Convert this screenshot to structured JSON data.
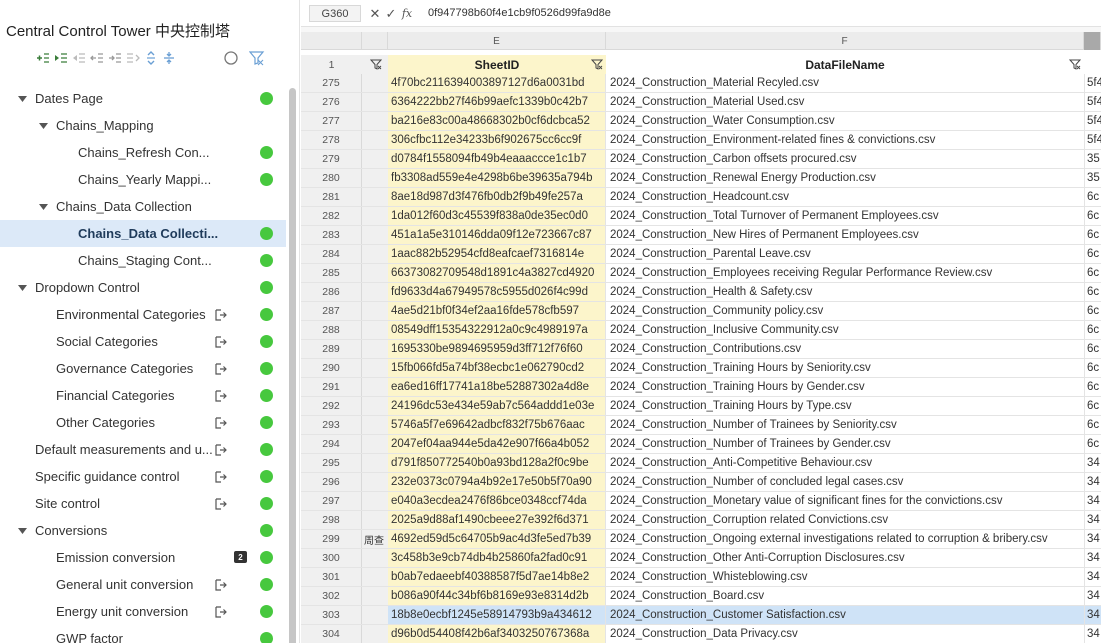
{
  "sidebar": {
    "title": "Central Control Tower 中央控制塔",
    "tree": [
      {
        "label": "Dates Page",
        "level": 0,
        "expanded": true,
        "status": "green"
      },
      {
        "label": "Chains_Mapping",
        "level": 1,
        "expanded": true
      },
      {
        "label": "Chains_Refresh Con...",
        "level": 2,
        "status": "green"
      },
      {
        "label": "Chains_Yearly Mappi...",
        "level": 2,
        "status": "green"
      },
      {
        "label": "Chains_Data Collection",
        "level": 1,
        "expanded": true
      },
      {
        "label": "Chains_Data Collecti...",
        "level": 2,
        "status": "green",
        "selected": true
      },
      {
        "label": "Chains_Staging Cont...",
        "level": 2,
        "status": "green"
      },
      {
        "label": "Dropdown Control",
        "level": 0,
        "expanded": true,
        "status": "green"
      },
      {
        "label": "Environmental Categories",
        "level": 1,
        "link": true,
        "status": "green"
      },
      {
        "label": "Social Categories",
        "level": 1,
        "link": true,
        "status": "green"
      },
      {
        "label": "Governance Categories",
        "level": 1,
        "link": true,
        "status": "green"
      },
      {
        "label": "Financial Categories",
        "level": 1,
        "link": true,
        "status": "green"
      },
      {
        "label": "Other Categories",
        "level": 1,
        "link": true,
        "status": "green"
      },
      {
        "label": "Default measurements and u...",
        "level": 0,
        "link": true,
        "status": "green"
      },
      {
        "label": "Specific guidance control",
        "level": 0,
        "link": true,
        "status": "green"
      },
      {
        "label": "Site control",
        "level": 0,
        "link": true,
        "status": "green"
      },
      {
        "label": "Conversions",
        "level": 0,
        "expanded": true,
        "status": "green"
      },
      {
        "label": "Emission conversion",
        "level": 1,
        "badge": "2",
        "status": "green"
      },
      {
        "label": "General unit conversion",
        "level": 1,
        "link": true,
        "status": "green"
      },
      {
        "label": "Energy unit conversion",
        "level": 1,
        "link": true,
        "status": "green"
      },
      {
        "label": "GWP factor",
        "level": 1,
        "status": "green"
      }
    ]
  },
  "formula_bar": {
    "cell_ref": "G360",
    "value": "0f947798b60f4e1cb9f0526d99fa9d8e"
  },
  "sheet": {
    "column_letters": {
      "E": "E",
      "F": "F"
    },
    "header_row_number": "1",
    "headers": {
      "E": "SheetID",
      "F": "DataFileName"
    },
    "rows": [
      {
        "n": "275",
        "d": "",
        "e": "4f70bc2116394003897127d6a0031bd",
        "f": "2024_Construction_Material Recyled.csv",
        "g": "5f4"
      },
      {
        "n": "276",
        "d": "",
        "e": "6364222bb27f46b99aefc1339b0c42b7",
        "f": "2024_Construction_Material Used.csv",
        "g": "5f4"
      },
      {
        "n": "277",
        "d": "",
        "e": "ba216e83c00a48668302b0cf6dcbca52",
        "f": "2024_Construction_Water Consumption.csv",
        "g": "5f4"
      },
      {
        "n": "278",
        "d": "",
        "e": "306cfbc112e34233b6f902675cc6cc9f",
        "f": "2024_Construction_Environment-related fines & convictions.csv",
        "g": "5f4"
      },
      {
        "n": "279",
        "d": "",
        "e": "d0784f1558094fb49b4eaaaccce1c1b7",
        "f": "2024_Construction_Carbon offsets procured.csv",
        "g": "35"
      },
      {
        "n": "280",
        "d": "",
        "e": "fb3308ad559e4e4298b6be39635a794b",
        "f": "2024_Construction_Renewal Energy Production.csv",
        "g": "35"
      },
      {
        "n": "281",
        "d": "",
        "e": "8ae18d987d3f476fb0db2f9b49fe257a",
        "f": "2024_Construction_Headcount.csv",
        "g": "6c"
      },
      {
        "n": "282",
        "d": "",
        "e": "1da012f60d3c45539f838a0de35ec0d0",
        "f": "2024_Construction_Total Turnover of Permanent Employees.csv",
        "g": "6c"
      },
      {
        "n": "283",
        "d": "",
        "e": "451a1a5e310146dda09f12e723667c87",
        "f": "2024_Construction_New Hires of Permanent Employees.csv",
        "g": "6c"
      },
      {
        "n": "284",
        "d": "",
        "e": "1aac882b52954cfd8eafcaef7316814e",
        "f": "2024_Construction_Parental Leave.csv",
        "g": "6c"
      },
      {
        "n": "285",
        "d": "",
        "e": "66373082709548d1891c4a3827cd4920",
        "f": "2024_Construction_Employees receiving Regular Performance Review.csv",
        "g": "6c"
      },
      {
        "n": "286",
        "d": "",
        "e": "fd9633d4a67949578c5955d026f4c99d",
        "f": "2024_Construction_Health & Safety.csv",
        "g": "6c"
      },
      {
        "n": "287",
        "d": "",
        "e": "4ae5d21bf0f34ef2aa16fde578cfb597",
        "f": "2024_Construction_Community policy.csv",
        "g": "6c"
      },
      {
        "n": "288",
        "d": "",
        "e": "08549dff15354322912a0c9c4989197a",
        "f": "2024_Construction_Inclusive Community.csv",
        "g": "6c"
      },
      {
        "n": "289",
        "d": "",
        "e": "1695330be9894695959d3ff712f76f60",
        "f": "2024_Construction_Contributions.csv",
        "g": "6c"
      },
      {
        "n": "290",
        "d": "",
        "e": "15fb066fd5a74bf38ecbc1e062790cd2",
        "f": "2024_Construction_Training Hours by Seniority.csv",
        "g": "6c"
      },
      {
        "n": "291",
        "d": "",
        "e": "ea6ed16ff17741a18be52887302a4d8e",
        "f": "2024_Construction_Training Hours by Gender.csv",
        "g": "6c"
      },
      {
        "n": "292",
        "d": "",
        "e": "24196dc53e434e59ab7c564addd1e03e",
        "f": "2024_Construction_Training Hours by Type.csv",
        "g": "6c"
      },
      {
        "n": "293",
        "d": "",
        "e": "5746a5f7e69642adbcf832f75b676aac",
        "f": "2024_Construction_Number of Trainees by Seniority.csv",
        "g": "6c"
      },
      {
        "n": "294",
        "d": "",
        "e": "2047ef04aa944e5da42e907f66a4b052",
        "f": "2024_Construction_Number of Trainees by Gender.csv",
        "g": "6c"
      },
      {
        "n": "295",
        "d": "",
        "e": "d791f850772540b0a93bd128a2f0c9be",
        "f": "2024_Construction_Anti-Competitive Behaviour.csv",
        "g": "34"
      },
      {
        "n": "296",
        "d": "",
        "e": "232e0373c0794a4b92e17e50b5f70a90",
        "f": "2024_Construction_Number of concluded legal cases.csv",
        "g": "34"
      },
      {
        "n": "297",
        "d": "",
        "e": "e040a3ecdea2476f86bce0348ccf74da",
        "f": "2024_Construction_Monetary value of significant fines for the convictions.csv",
        "g": "34"
      },
      {
        "n": "298",
        "d": "",
        "e": "2025a9d88af1490cbeee27e392f6d371",
        "f": "2024_Construction_Corruption related Convictions.csv",
        "g": "34"
      },
      {
        "n": "299",
        "d": "周查",
        "e": "4692ed59d5c64705b9ac4d3fe5ed7b39",
        "f": "2024_Construction_Ongoing external investigations related to corruption & bribery.csv",
        "g": "34"
      },
      {
        "n": "300",
        "d": "",
        "e": "3c458b3e9cb74db4b25860fa2fad0c91",
        "f": "2024_Construction_Other Anti-Corruption Disclosures.csv",
        "g": "34"
      },
      {
        "n": "301",
        "d": "",
        "e": "b0ab7edaeebf40388587f5d7ae14b8e2",
        "f": "2024_Construction_Whisteblowing.csv",
        "g": "34"
      },
      {
        "n": "302",
        "d": "",
        "e": "b086a90f44c34bf6b8169e93e8314d2b",
        "f": "2024_Construction_Board.csv",
        "g": "34"
      },
      {
        "n": "303",
        "d": "",
        "e": "18b8e0ecbf1245e58914793b9a434612",
        "f": "2024_Construction_Customer Satisfaction.csv",
        "g": "34",
        "selected": true
      },
      {
        "n": "304",
        "d": "",
        "e": "d96b0d54408f42b6af3403250767368a",
        "f": "2024_Construction_Data Privacy.csv",
        "g": "34"
      }
    ]
  }
}
